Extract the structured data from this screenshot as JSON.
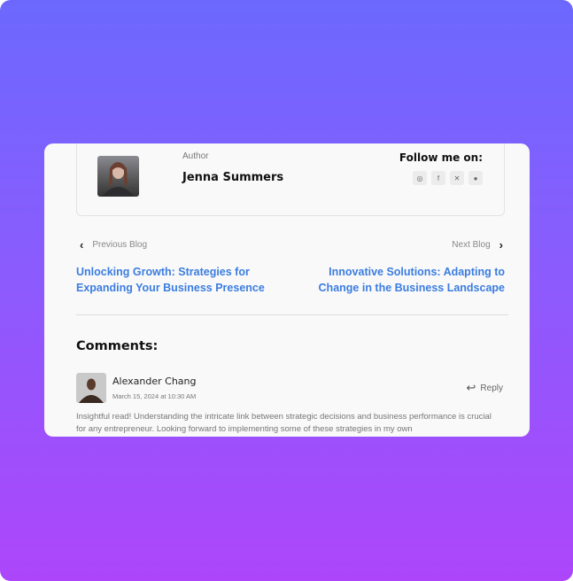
{
  "author": {
    "label": "Author",
    "name": "Jenna Summers",
    "follow_label": "Follow me on:",
    "socials": [
      {
        "icon": "instagram-icon",
        "glyph": "◎"
      },
      {
        "icon": "facebook-icon",
        "glyph": "f"
      },
      {
        "icon": "x-icon",
        "glyph": "✕"
      },
      {
        "icon": "reddit-icon",
        "glyph": "●"
      }
    ]
  },
  "navigation": {
    "previous_label": "Previous Blog",
    "next_label": "Next Blog",
    "previous_title": "Unlocking Growth: Strategies for Expanding Your Business Presence",
    "next_title": "Innovative Solutions: Adapting to Change in the Business Landscape"
  },
  "comments": {
    "title": "Comments:",
    "items": [
      {
        "name": "Alexander Chang",
        "date": "March 15, 2024 at 10:30 AM",
        "reply_label": "Reply",
        "text": "Insightful read! Understanding the intricate link between strategic decisions and business performance is crucial for any entrepreneur. Looking forward to implementing some of these strategies in my own"
      }
    ]
  },
  "colors": {
    "link": "#3b7de0",
    "gradient_top": "#6c68fe",
    "gradient_bottom": "#ad46fb"
  }
}
